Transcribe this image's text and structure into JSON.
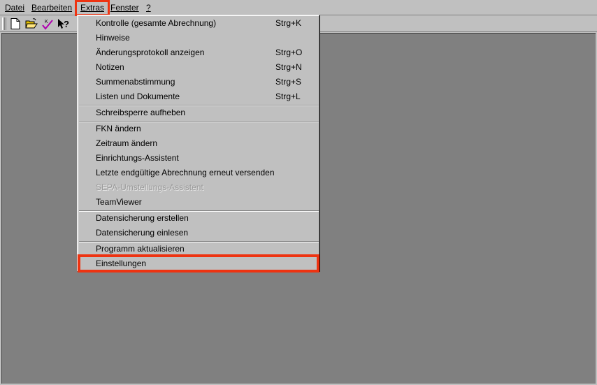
{
  "menubar": {
    "datei": "Datei",
    "bearbeiten": "Bearbeiten",
    "extras": "Extras",
    "fenster": "Fenster",
    "help": "?"
  },
  "toolbar": {
    "icons": [
      "new-document-icon",
      "open-folder-icon",
      "check-icon",
      "help-pointer-icon"
    ]
  },
  "colors": {
    "highlight": "#ee3311",
    "workspace": "#808080",
    "chrome": "#c0c0c0"
  },
  "extras_menu": {
    "items": [
      {
        "label": "Kontrolle (gesamte Abrechnung)",
        "shortcut": "Strg+K"
      },
      {
        "label": "Hinweise",
        "shortcut": ""
      },
      {
        "label": "Änderungsprotokoll anzeigen",
        "shortcut": "Strg+O"
      },
      {
        "label": "Notizen",
        "shortcut": "Strg+N"
      },
      {
        "label": "Summenabstimmung",
        "shortcut": "Strg+S"
      },
      {
        "label": "Listen und Dokumente",
        "shortcut": "Strg+L"
      },
      {
        "label": "Schreibsperre aufheben",
        "shortcut": ""
      },
      {
        "label": "FKN ändern",
        "shortcut": ""
      },
      {
        "label": "Zeitraum ändern",
        "shortcut": ""
      },
      {
        "label": "Einrichtungs-Assistent",
        "shortcut": ""
      },
      {
        "label": "Letzte endgültige Abrechnung erneut versenden",
        "shortcut": ""
      },
      {
        "label": "SEPA-Umstellungs-Assistent",
        "shortcut": "",
        "disabled": true
      },
      {
        "label": "TeamViewer",
        "shortcut": ""
      },
      {
        "label": "Datensicherung erstellen",
        "shortcut": ""
      },
      {
        "label": "Datensicherung einlesen",
        "shortcut": ""
      },
      {
        "label": "Programm aktualisieren",
        "shortcut": ""
      },
      {
        "label": "Einstellungen",
        "shortcut": "",
        "highlighted": true
      }
    ]
  }
}
